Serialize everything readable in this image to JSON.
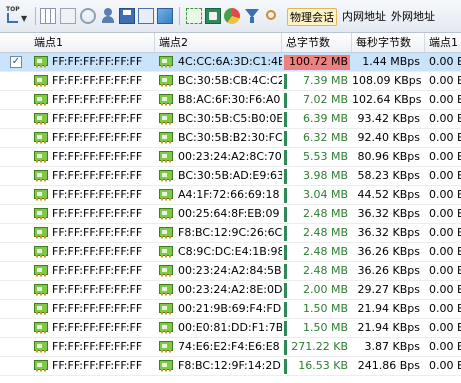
{
  "toolbar": {
    "top_label": "TOP",
    "tabs": [
      "物理会话",
      "内网地址",
      "外网地址"
    ],
    "active_tab": 0
  },
  "columns": [
    "端点1",
    "端点2",
    "总字节数",
    "每秒字节数",
    "端点1"
  ],
  "rows": [
    {
      "e1": "FF:FF:FF:FF:FF:FF",
      "e2": "4C:CC:6A:3D:C1:4E",
      "total": "100.72 MB",
      "rate": "1.44 MBps",
      "e1b": "0.00 B",
      "fill": 1.0,
      "selected": true
    },
    {
      "e1": "FF:FF:FF:FF:FF:FF",
      "e2": "BC:30:5B:CB:4C:C2",
      "total": "7.39 MB",
      "rate": "108.09 KBps",
      "e1b": "0.00 B",
      "fill": 0.073
    },
    {
      "e1": "FF:FF:FF:FF:FF:FF",
      "e2": "B8:AC:6F:30:F6:A0",
      "total": "7.02 MB",
      "rate": "102.64 KBps",
      "e1b": "0.00 B",
      "fill": 0.07
    },
    {
      "e1": "FF:FF:FF:FF:FF:FF",
      "e2": "BC:30:5B:C5:B0:0E",
      "total": "6.39 MB",
      "rate": "93.42 KBps",
      "e1b": "0.00 B",
      "fill": 0.063
    },
    {
      "e1": "FF:FF:FF:FF:FF:FF",
      "e2": "BC:30:5B:B2:30:FC",
      "total": "6.32 MB",
      "rate": "92.40 KBps",
      "e1b": "0.00 B",
      "fill": 0.063
    },
    {
      "e1": "FF:FF:FF:FF:FF:FF",
      "e2": "00:23:24:A2:8C:70",
      "total": "5.53 MB",
      "rate": "80.96 KBps",
      "e1b": "0.00 B",
      "fill": 0.055
    },
    {
      "e1": "FF:FF:FF:FF:FF:FF",
      "e2": "BC:30:5B:AD:E9:63",
      "total": "3.98 MB",
      "rate": "58.23 KBps",
      "e1b": "0.00 B",
      "fill": 0.04
    },
    {
      "e1": "FF:FF:FF:FF:FF:FF",
      "e2": "A4:1F:72:66:69:18",
      "total": "3.04 MB",
      "rate": "44.52 KBps",
      "e1b": "0.00 B",
      "fill": 0.03
    },
    {
      "e1": "FF:FF:FF:FF:FF:FF",
      "e2": "00:25:64:8F:EB:09",
      "total": "2.48 MB",
      "rate": "36.32 KBps",
      "e1b": "0.00 B",
      "fill": 0.025
    },
    {
      "e1": "FF:FF:FF:FF:FF:FF",
      "e2": "F8:BC:12:9C:26:6C",
      "total": "2.48 MB",
      "rate": "36.32 KBps",
      "e1b": "0.00 B",
      "fill": 0.025
    },
    {
      "e1": "FF:FF:FF:FF:FF:FF",
      "e2": "C8:9C:DC:E4:1B:98",
      "total": "2.48 MB",
      "rate": "36.26 KBps",
      "e1b": "0.00 B",
      "fill": 0.025
    },
    {
      "e1": "FF:FF:FF:FF:FF:FF",
      "e2": "00:23:24:A2:84:5B",
      "total": "2.48 MB",
      "rate": "36.26 KBps",
      "e1b": "0.00 B",
      "fill": 0.025
    },
    {
      "e1": "FF:FF:FF:FF:FF:FF",
      "e2": "00:23:24:A2:8E:0D:19",
      "total": "2.00 MB",
      "rate": "29.27 KBps",
      "e1b": "0.00 B",
      "fill": 0.02
    },
    {
      "e1": "FF:FF:FF:FF:FF:FF",
      "e2": "00:21:9B:69:F4:FD",
      "total": "1.50 MB",
      "rate": "21.94 KBps",
      "e1b": "0.00 B",
      "fill": 0.015
    },
    {
      "e1": "FF:FF:FF:FF:FF:FF",
      "e2": "00:E0:81:DD:F1:7B",
      "total": "1.50 MB",
      "rate": "21.94 KBps",
      "e1b": "0.00 B",
      "fill": 0.015
    },
    {
      "e1": "FF:FF:FF:FF:FF:FF",
      "e2": "74:E6:E2:F4:E6:E8",
      "total": "271.22 KB",
      "rate": "3.87 KBps",
      "e1b": "0.00 B",
      "fill": 0.003
    },
    {
      "e1": "FF:FF:FF:FF:FF:FF",
      "e2": "F8:BC:12:9F:14:2D",
      "total": "16.53 KB",
      "rate": "241.86 Bps",
      "e1b": "0.00 B",
      "fill": 0.001
    }
  ],
  "colors": {
    "bar_green": "#2e8b57",
    "bar_red": "#f08080",
    "selection": "#c9e3fb"
  }
}
